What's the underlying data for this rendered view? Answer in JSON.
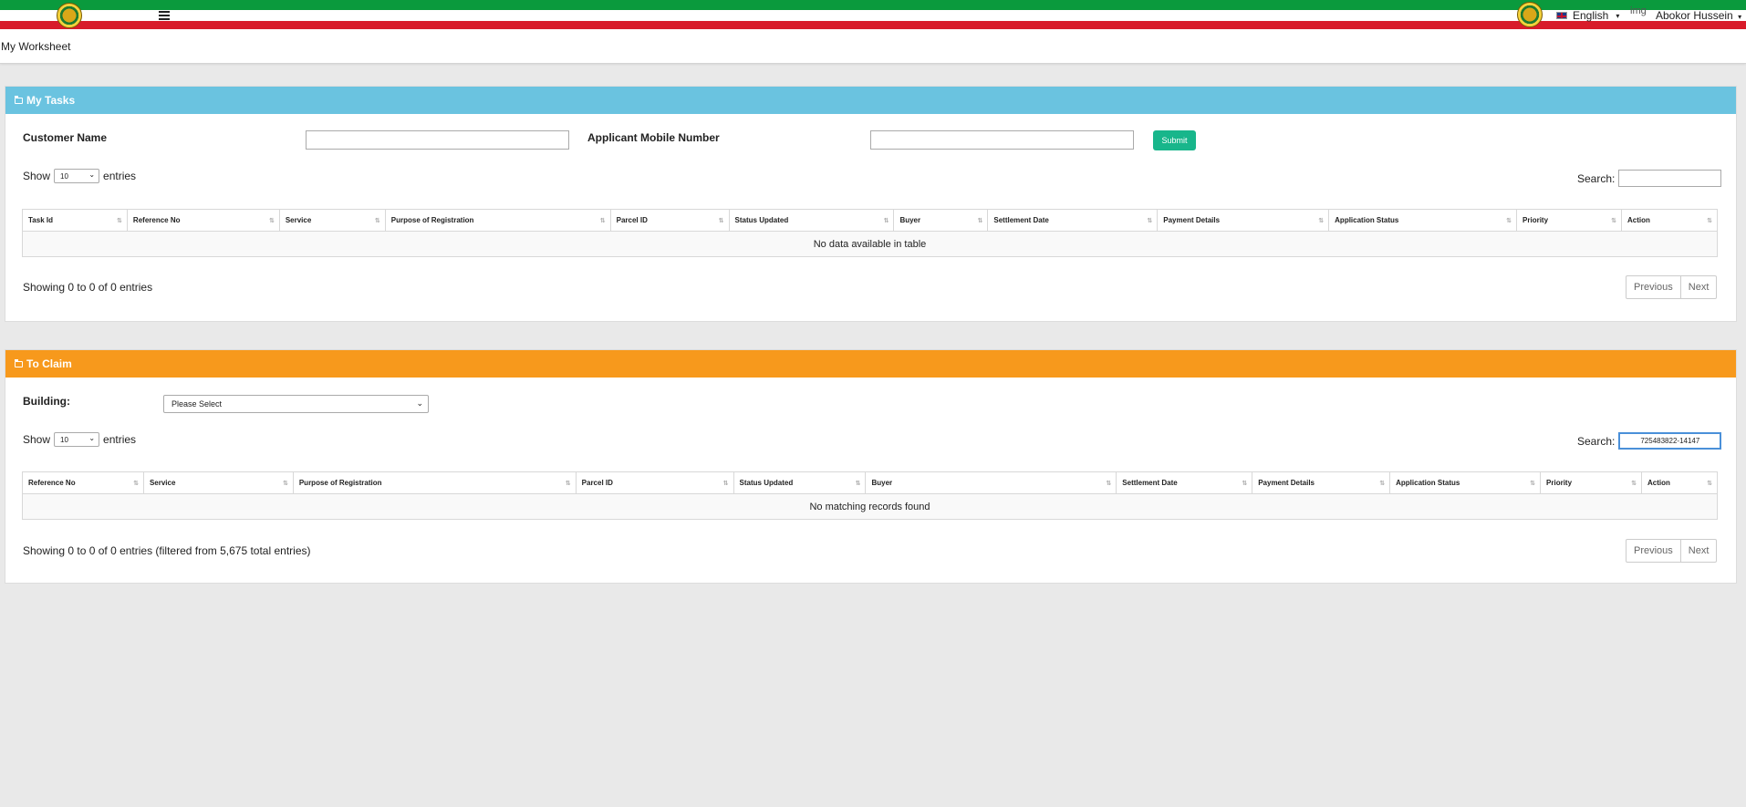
{
  "header": {
    "language": "English",
    "img_alt": "img",
    "user": "Abokor Hussein"
  },
  "breadcrumb": "My Worksheet",
  "my_tasks": {
    "title": "My Tasks",
    "customer_name_label": "Customer Name",
    "mobile_label": "Applicant Mobile Number",
    "submit_label": "Submit",
    "show_label": "Show",
    "entries_value": "10",
    "entries_label": "entries",
    "search_label": "Search:",
    "search_value": "",
    "columns": [
      "Task Id",
      "Reference No",
      "Service",
      "Purpose of Registration",
      "Parcel ID",
      "Status Updated",
      "Buyer",
      "Settlement Date",
      "Payment Details",
      "Application Status",
      "Priority",
      "Action"
    ],
    "empty_text": "No data available in table",
    "info": "Showing 0 to 0 of 0 entries",
    "prev": "Previous",
    "next": "Next"
  },
  "to_claim": {
    "title": "To Claim",
    "building_label": "Building:",
    "building_value": "Please Select",
    "show_label": "Show",
    "entries_value": "10",
    "entries_label": "entries",
    "search_label": "Search:",
    "search_value": "725483822-14147",
    "columns": [
      "Reference No",
      "Service",
      "Purpose of Registration",
      "Parcel ID",
      "Status Updated",
      "Buyer",
      "Settlement Date",
      "Payment Details",
      "Application Status",
      "Priority",
      "Action"
    ],
    "empty_text": "No matching records found",
    "info": "Showing 0 to 0 of 0 entries (filtered from 5,675 total entries)",
    "prev": "Previous",
    "next": "Next"
  },
  "colors": {
    "green_stripe": "#0a9a3d",
    "red_stripe": "#d81b2a",
    "my_tasks_header": "#6ac3e0",
    "to_claim_header": "#f7991c",
    "submit_button": "#18b68b"
  }
}
